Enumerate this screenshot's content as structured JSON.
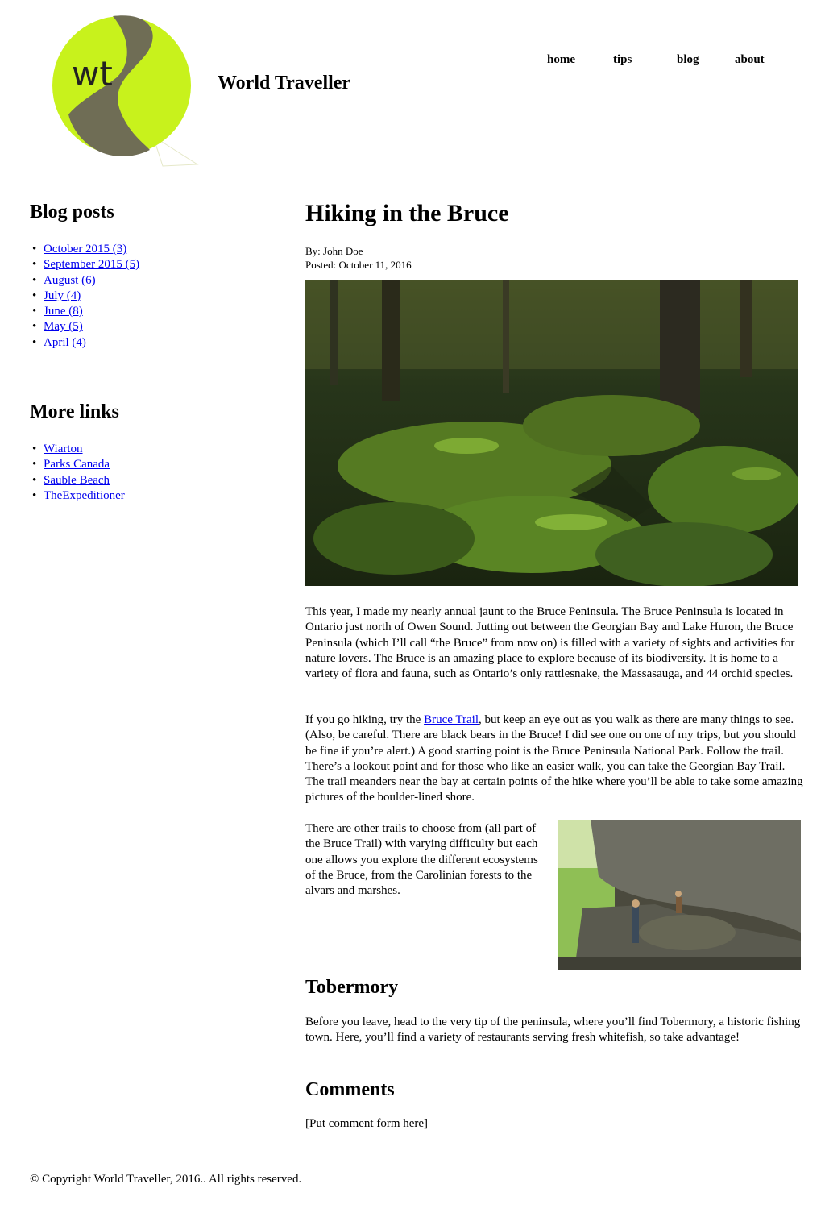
{
  "header": {
    "logo_text": "wt",
    "site_title": "World Traveller",
    "nav": [
      "home",
      "tips",
      "blog",
      "about"
    ]
  },
  "sidebar": {
    "blog_posts_heading": "Blog posts",
    "archives": [
      "October 2015 (3)",
      "September 2015 (5)",
      "August (6)",
      "July (4)",
      "June (8)",
      "May (5)",
      "April (4)"
    ],
    "more_links_heading": "More links",
    "links": [
      "Wiarton",
      "Parks Canada",
      "Sauble Beach",
      "TheExpeditioner"
    ]
  },
  "post": {
    "title": "Hiking in the Bruce",
    "author": "By: John Doe",
    "posted": "Posted:  October 11, 2016",
    "p1": "This year, I made my nearly annual jaunt to the Bruce Peninsula. The Bruce Peninsula is located in Ontario just north of Owen Sound. Jutting out between the Georgian Bay and Lake Huron, the Bruce Peninsula (which I’ll call “the Bruce” from now on) is filled with a variety of sights and activities for nature lovers. The Bruce is an amazing place to explore because of its biodiversity. It is home to a variety of flora and fauna, such as Ontario’s only rattlesnake, the Massasauga, and 44 orchid species.",
    "p2_before": "If you go hiking, try the ",
    "p2_link": "Bruce Trail",
    "p2_after": ", but keep an eye out as you walk as there are many things to see. (Also, be careful. There are black bears in the Bruce! I did see one on one of my trips, but you should be fine if you’re alert.) A good starting point is the Bruce Peninsula National Park. Follow the trail. There’s a lookout point and for those who like an easier walk, you can take the Georgian Bay Trail. The trail meanders near the bay at certain points of the hike where you’ll be able to take some amazing pictures of the boulder-lined shore.",
    "p3": "There are other trails to choose from (all part of the Bruce Trail) with varying difficulty but each one allows you explore the different ecosystems of the Bruce, from the Carolinian forests to the alvars and marshes.",
    "h_tobermory": "Tobermory",
    "p4": "Before you leave, head to the very tip of the peninsula, where you’ll find Tobermory, a historic fishing town. Here, you’ll find a variety of restaurants serving fresh whitefish, so take advantage!",
    "h_comments": "Comments",
    "comment_placeholder": "[Put comment form here]"
  },
  "footer": {
    "copyright": "© Copyright World Traveller, 2016.. All rights reserved."
  },
  "colors": {
    "logo_lime": "#c8f21c",
    "logo_path": "#6f6d55",
    "link": "#0000ee"
  }
}
